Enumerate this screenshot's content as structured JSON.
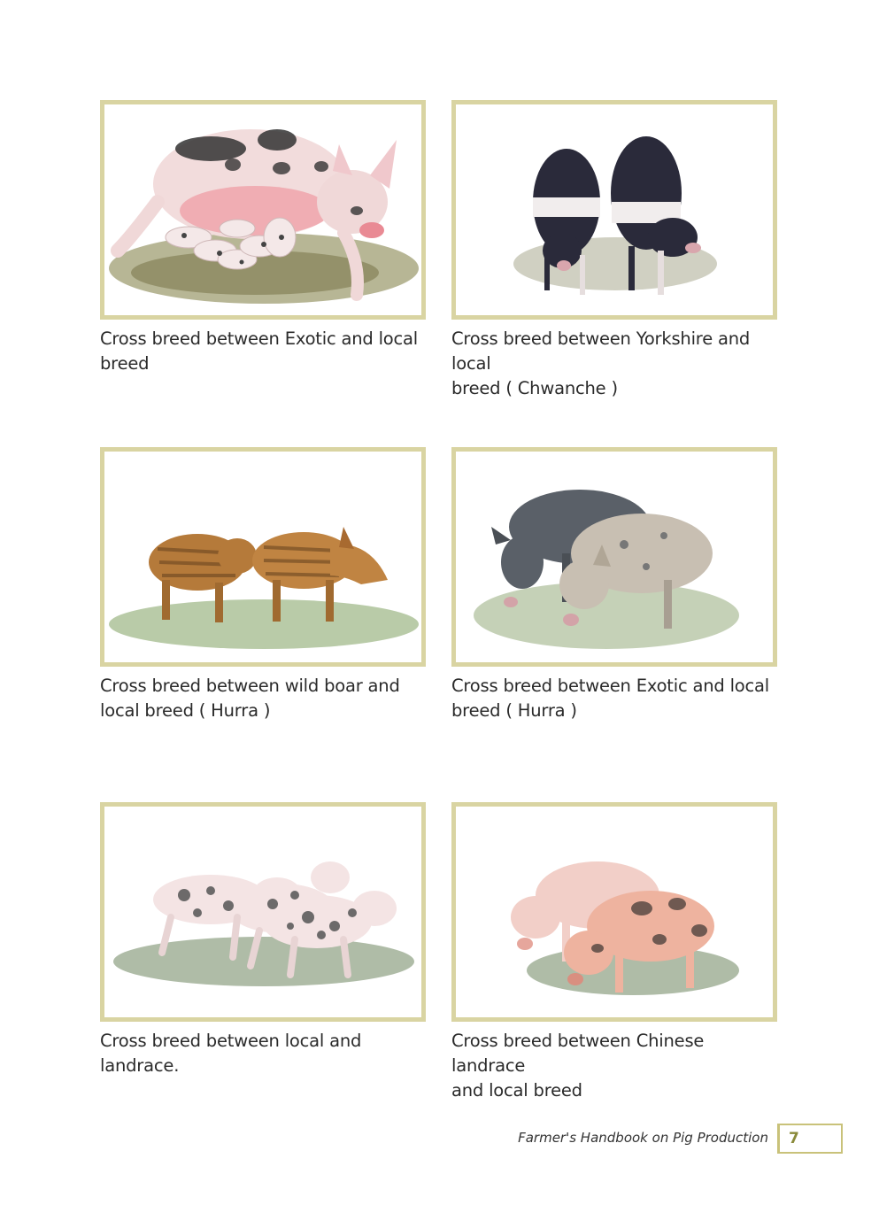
{
  "cards": [
    {
      "caption": "Cross breed between Exotic and local\nbreed"
    },
    {
      "caption": "Cross breed between Yorkshire and local\nbreed ( Chwanche )"
    },
    {
      "caption": "Cross breed between wild boar and\nlocal breed ( Hurra )"
    },
    {
      "caption": "Cross breed between Exotic and local\nbreed ( Hurra )"
    },
    {
      "caption": "Cross breed between local and landrace."
    },
    {
      "caption": "Cross breed between Chinese landrace\nand local breed"
    }
  ],
  "footer": {
    "title": "Farmer's Handbook on Pig Production",
    "page_number": "7"
  },
  "colors": {
    "frame_border": "#d9d4a2",
    "page_box_border": "#c9c27a",
    "page_number_text": "#8a8a3a"
  }
}
